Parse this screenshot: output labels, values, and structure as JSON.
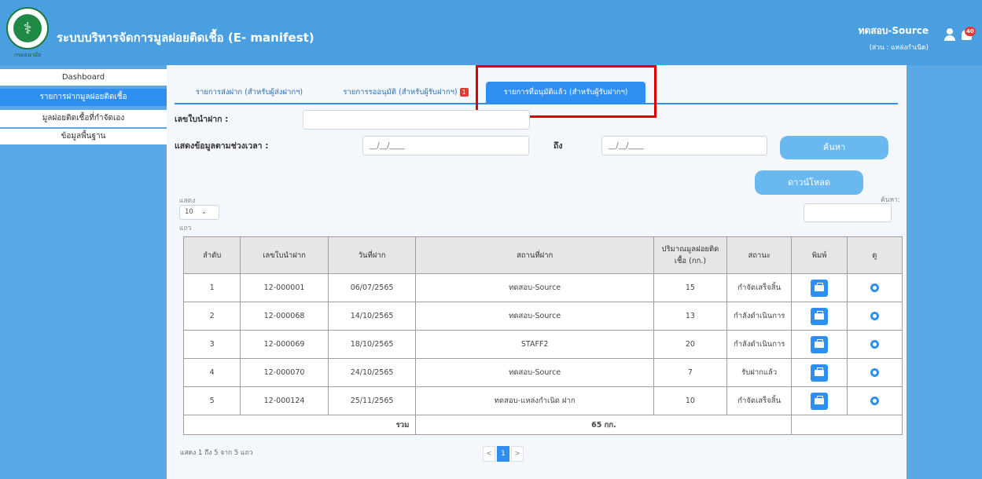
{
  "header": {
    "app_title": "ระบบบริหารจัดการมูลฝอยติดเชื้อ (E- manifest)",
    "logo_text": "กรมอนามัย",
    "user_name": "ทดสอบ-Source",
    "user_role": "(ส่วน : แหล่งกำเนิด)",
    "notification_count": "40"
  },
  "sidebar": {
    "items": [
      {
        "label": "Dashboard"
      },
      {
        "label": "รายการฝากมูลฝอยติดเชื้อ"
      },
      {
        "label": "มูลฝอยติดเชื้อที่กำจัดเอง"
      },
      {
        "label": "ข้อมูลพื้นฐาน"
      }
    ]
  },
  "tabs": [
    {
      "label": "รายการส่งฝาก (สำหรับผู้ส่งฝากฯ)"
    },
    {
      "label": "รายการรออนุมัติ (สำหรับผู้รับฝากฯ)",
      "badge": "1"
    },
    {
      "label": "รายการที่อนุมัติแล้ว (สำหรับผู้รับฝากฯ)"
    }
  ],
  "filters": {
    "doc_label": "เลขใบนำฝาก :",
    "doc_value": "",
    "date_label": "แสดงข้อมูลตามช่วงเวลา :",
    "date_from": "__/__/____",
    "to_label": "ถึง",
    "date_to": "__/__/____",
    "search_button": "ค้นหา",
    "download_button": "ดาวน์โหลด"
  },
  "table_controls": {
    "show_label": "แสดง",
    "page_size": "10",
    "rows_label": "แถว",
    "search_label": "ค้นหา:"
  },
  "table": {
    "columns": [
      "ลำดับ",
      "เลขใบนำฝาก",
      "วันที่ฝาก",
      "สถานที่ฝาก",
      "ปริมาณมูลฝอยติดเชื้อ (กก.)",
      "สถานะ",
      "พิมพ์",
      "ดู"
    ],
    "rows": [
      {
        "no": "1",
        "doc": "12-000001",
        "date": "06/07/2565",
        "place": "ทดสอบ-Source",
        "qty": "15",
        "status": "กำจัดเสร็จสิ้น"
      },
      {
        "no": "2",
        "doc": "12-000068",
        "date": "14/10/2565",
        "place": "ทดสอบ-Source",
        "qty": "13",
        "status": "กำลังดำเนินการ"
      },
      {
        "no": "3",
        "doc": "12-000069",
        "date": "18/10/2565",
        "place": "STAFF2",
        "qty": "20",
        "status": "กำลังดำเนินการ"
      },
      {
        "no": "4",
        "doc": "12-000070",
        "date": "24/10/2565",
        "place": "ทดสอบ-Source",
        "qty": "7",
        "status": "รับฝากแล้ว"
      },
      {
        "no": "5",
        "doc": "12-000124",
        "date": "25/11/2565",
        "place": "ทดสอบ-แหล่งกำเนิด ฝาก",
        "qty": "10",
        "status": "กำจัดเสร็จสิ้น"
      }
    ],
    "total_label": "รวม",
    "total_value": "65 กก."
  },
  "footer": {
    "info": "แสดง 1 ถึง 5 จาก 5 แถว",
    "prev": "<",
    "page": "1",
    "next": ">"
  },
  "colors": {
    "primary": "#2f8ff0",
    "header_bg": "#4a9fe0",
    "highlight": "#e00000"
  }
}
